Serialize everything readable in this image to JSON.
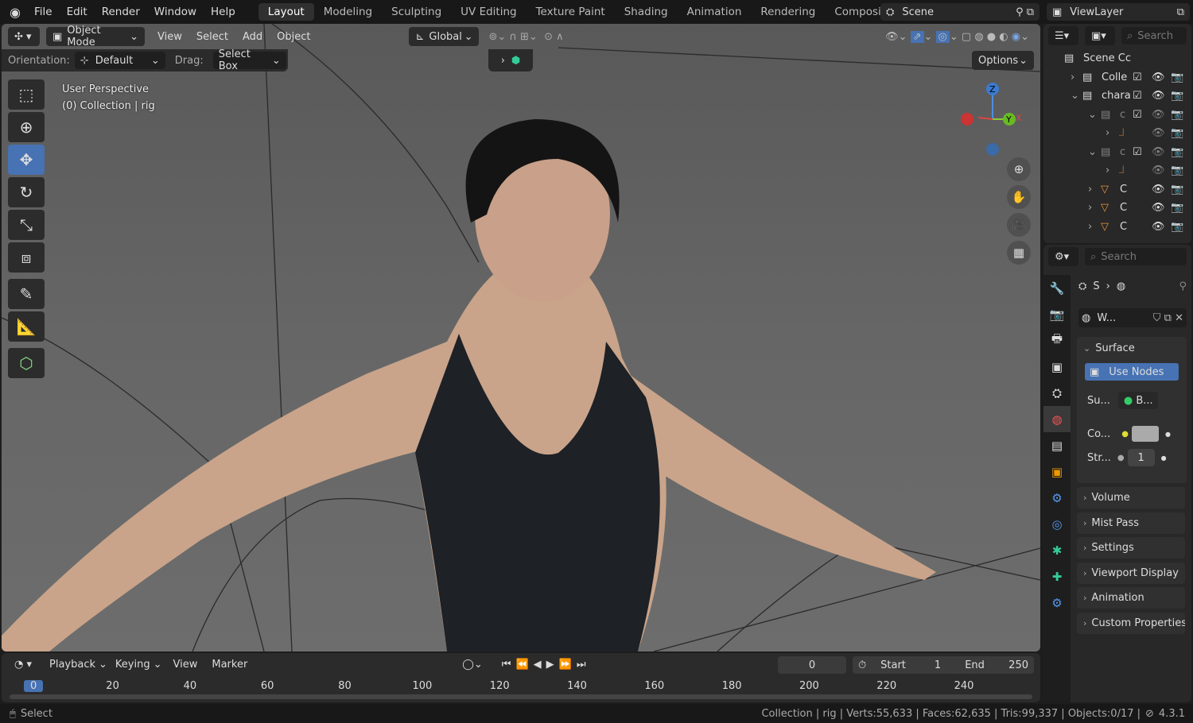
{
  "topbar": {
    "menus": [
      "File",
      "Edit",
      "Render",
      "Window",
      "Help"
    ],
    "workspaces": [
      "Layout",
      "Modeling",
      "Sculpting",
      "UV Editing",
      "Texture Paint",
      "Shading",
      "Animation",
      "Rendering",
      "Compositing"
    ],
    "active_workspace": "Layout",
    "scene": "Scene",
    "view_layer": "ViewLayer"
  },
  "viewport": {
    "mode": "Object Mode",
    "menus": [
      "View",
      "Select",
      "Add",
      "Object"
    ],
    "transform_orientation": "Global",
    "orientation_label": "Orientation:",
    "orientation_value": "Default",
    "drag_label": "Drag:",
    "drag_value": "Select Box",
    "options": "Options",
    "overlay_line1": "User Perspective",
    "overlay_line2": "(0) Collection | rig",
    "gizmo": {
      "x": "X",
      "y": "Y",
      "z": "Z"
    },
    "accent": "#4772b3"
  },
  "tools": [
    "select-box",
    "cursor",
    "move",
    "rotate",
    "scale",
    "transform",
    "annotate",
    "measure",
    "add-cube"
  ],
  "timeline": {
    "menus": [
      "Playback",
      "Keying",
      "View",
      "Marker"
    ],
    "current_frame": "0",
    "start_label": "Start",
    "start": "1",
    "end_label": "End",
    "end": "250",
    "ticks": [
      "0",
      "20",
      "40",
      "60",
      "80",
      "100",
      "120",
      "140",
      "160",
      "180",
      "200",
      "220",
      "240"
    ]
  },
  "status": {
    "left": "Select",
    "stats": "Collection | rig | Verts:55,633 | Faces:62,635 | Tris:99,337 | Objects:0/17 |",
    "version": "4.3.1"
  },
  "outliner": {
    "search_placeholder": "Search",
    "rows": [
      {
        "label": "Scene Cc",
        "indent": 0,
        "type": "scene"
      },
      {
        "label": "Colle",
        "indent": 1,
        "type": "collection",
        "check": true
      },
      {
        "label": "chara",
        "indent": 1,
        "type": "collection",
        "check": true,
        "open": true
      },
      {
        "label": "c",
        "indent": 2,
        "type": "collection",
        "check": true,
        "dim": true
      },
      {
        "label": "",
        "indent": 3,
        "type": "armature",
        "dim": true
      },
      {
        "label": "c",
        "indent": 2,
        "type": "collection",
        "check": true,
        "dim": true
      },
      {
        "label": "",
        "indent": 3,
        "type": "armature",
        "dim": true
      },
      {
        "label": "C",
        "indent": 2,
        "type": "mesh"
      },
      {
        "label": "C",
        "indent": 2,
        "type": "mesh"
      },
      {
        "label": "C",
        "indent": 2,
        "type": "mesh"
      }
    ]
  },
  "properties": {
    "search_placeholder": "Search",
    "breadcrumb": "S",
    "world_name": "W...",
    "surface": "Surface",
    "use_nodes": "Use Nodes",
    "surface_label": "Su...",
    "surface_value": "B...",
    "color_label": "Co...",
    "strength_label": "Str...",
    "strength_value": "1",
    "panels": [
      "Volume",
      "Mist Pass",
      "Settings",
      "Viewport Display",
      "Animation",
      "Custom Properties"
    ]
  }
}
